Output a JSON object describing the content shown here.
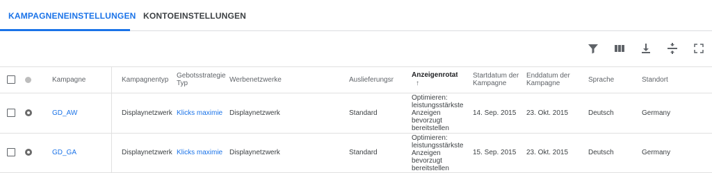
{
  "tabs": [
    {
      "label": "KAMPAGNENEINSTELLUNGEN",
      "active": true
    },
    {
      "label": "KONTOEINSTELLUNGEN",
      "active": false
    }
  ],
  "toolbar": {
    "icons": [
      "filter-icon",
      "columns-icon",
      "download-icon",
      "compact-icon",
      "fullscreen-icon"
    ]
  },
  "table": {
    "headers": {
      "campaign": "Kampagne",
      "type": "Kampagnentyp",
      "bid": "Gebotsstrategie Typ",
      "networks": "Werbenetzwerke",
      "delivery": "Auslieferungsmethode",
      "rotation": "Anzeigenrotation",
      "start": "Startdatum der Kampagne",
      "end": "Enddatum der Kampagne",
      "language": "Sprache",
      "location": "Standort"
    },
    "rows": [
      {
        "campaign": "GD_AW",
        "type": "Displaynetzwerk",
        "bid": "Klicks maximieren",
        "networks": "Displaynetzwerk",
        "delivery": "Standard",
        "rotation": "Optimieren: leistungsstärkste Anzeigen bevorzugt bereitstellen",
        "start": "14. Sep. 2015",
        "end": "23. Okt. 2015",
        "language": "Deutsch",
        "location": "Germany"
      },
      {
        "campaign": "GD_GA",
        "type": "Displaynetzwerk",
        "bid": "Klicks maximieren",
        "networks": "Displaynetzwerk",
        "delivery": "Standard",
        "rotation": "Optimieren: leistungsstärkste Anzeigen bevorzugt bereitstellen",
        "start": "15. Sep. 2015",
        "end": "23. Okt. 2015",
        "language": "Deutsch",
        "location": "Germany"
      }
    ]
  },
  "colors": {
    "accent": "#1a73e8",
    "text": "#3c4043",
    "border": "#e0e0e0"
  }
}
